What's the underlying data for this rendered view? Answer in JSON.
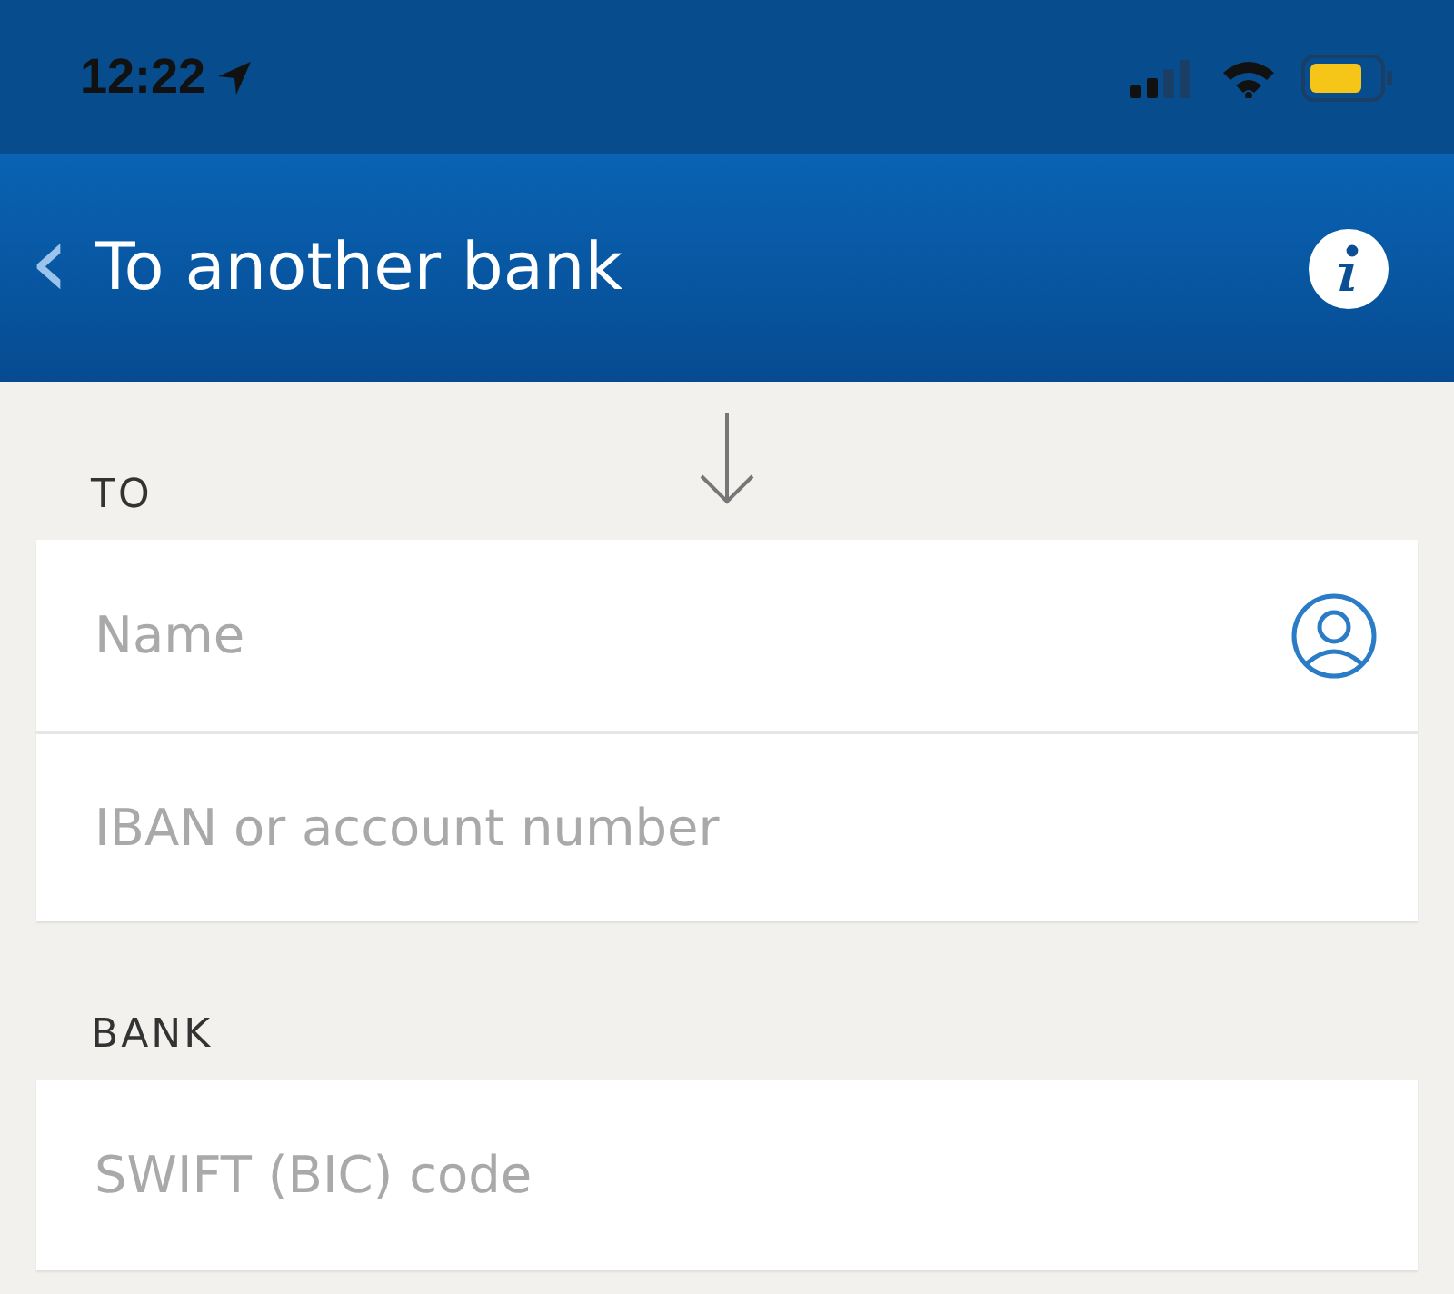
{
  "status_bar": {
    "time": "12:22"
  },
  "header": {
    "back_glyph": "‹",
    "title": "To another bank"
  },
  "sections": [
    {
      "label": "TO",
      "fields": [
        {
          "placeholder": "Name",
          "kind": "contact"
        },
        {
          "placeholder": "IBAN or account number",
          "kind": "plain"
        }
      ]
    },
    {
      "label": "BANK",
      "fields": [
        {
          "placeholder": "SWIFT (BIC) code",
          "kind": "plain"
        }
      ]
    }
  ]
}
